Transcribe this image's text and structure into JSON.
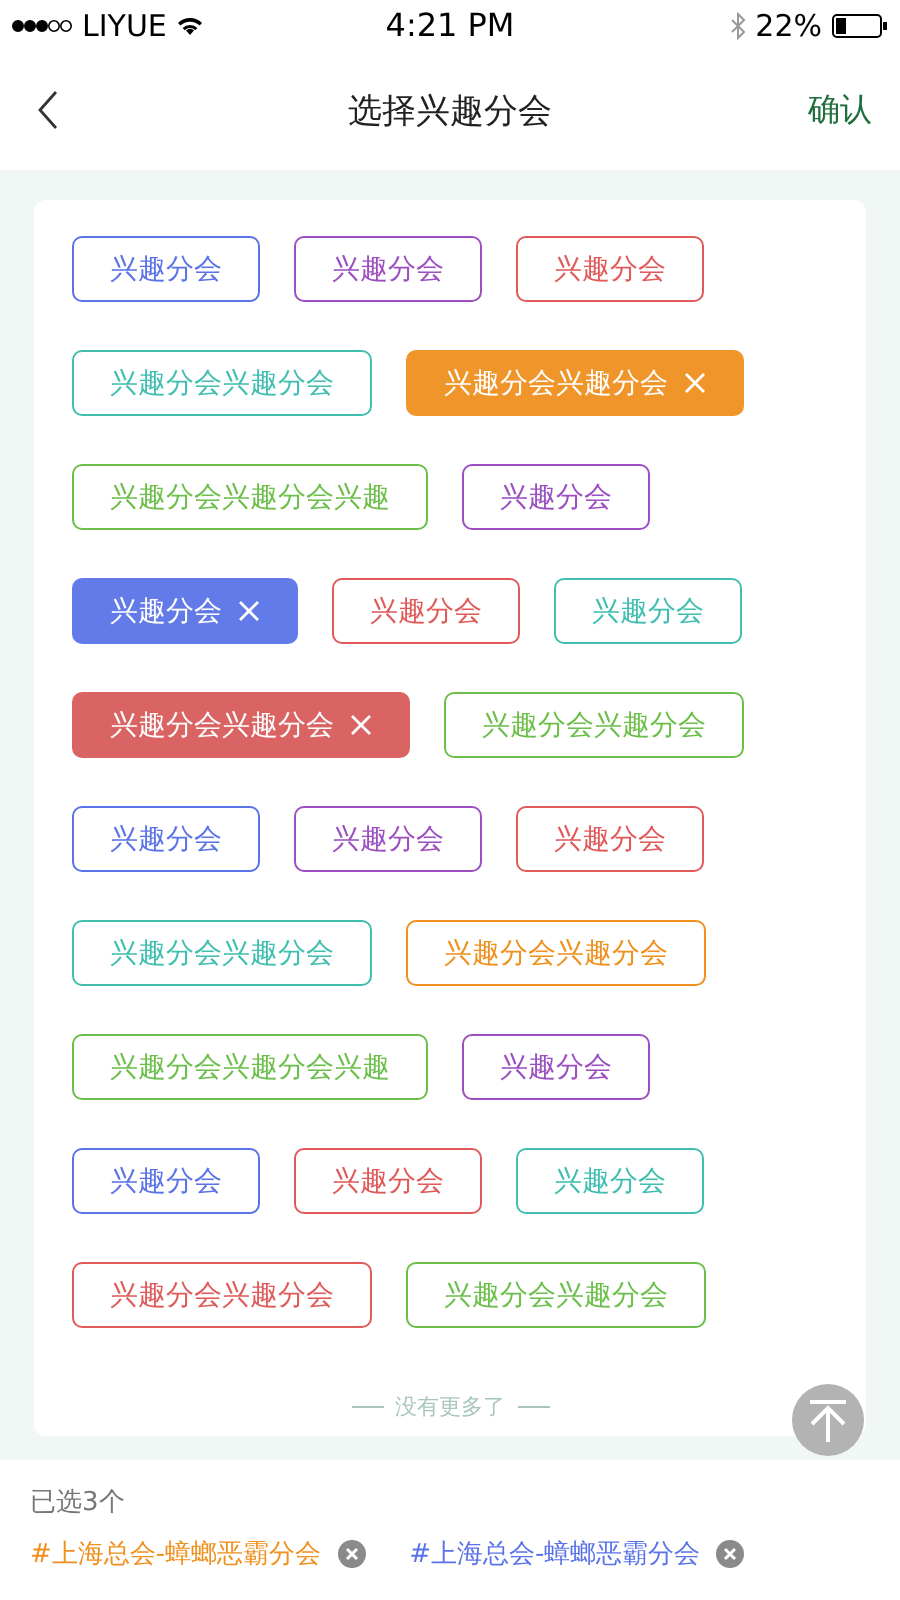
{
  "status_bar": {
    "carrier": "LIYUE",
    "time": "4:21 PM",
    "battery": "22%"
  },
  "nav": {
    "title": "选择兴趣分会",
    "confirm": "确认"
  },
  "tag_rows": [
    {
      "tags": [
        {
          "label": "兴趣分会",
          "color": "#5b73e8",
          "selected": false
        },
        {
          "label": "兴趣分会",
          "color": "#9b4fc0",
          "selected": false
        },
        {
          "label": "兴趣分会",
          "color": "#e05a5a",
          "selected": false
        }
      ]
    },
    {
      "tags": [
        {
          "label": "兴趣分会兴趣分会",
          "color": "#40bfb0",
          "selected": false
        },
        {
          "label": "兴趣分会兴趣分会",
          "color": "#f0901e",
          "selected": true
        }
      ]
    },
    {
      "tags": [
        {
          "label": "兴趣分会兴趣分会兴趣",
          "color": "#6cbf4a",
          "selected": false
        },
        {
          "label": "兴趣分会",
          "color": "#9b4fc0",
          "selected": false
        }
      ]
    },
    {
      "tags": [
        {
          "label": "兴趣分会",
          "color": "#5b73e8",
          "selected": true
        },
        {
          "label": "兴趣分会",
          "color": "#e05a5a",
          "selected": false
        },
        {
          "label": "兴趣分会",
          "color": "#40bfb0",
          "selected": false
        }
      ]
    },
    {
      "tags": [
        {
          "label": "兴趣分会兴趣分会",
          "color": "#d95c5c",
          "selected": true
        },
        {
          "label": "兴趣分会兴趣分会",
          "color": "#6cbf4a",
          "selected": false
        }
      ]
    },
    {
      "tags": [
        {
          "label": "兴趣分会",
          "color": "#5b73e8",
          "selected": false
        },
        {
          "label": "兴趣分会",
          "color": "#9b4fc0",
          "selected": false
        },
        {
          "label": "兴趣分会",
          "color": "#e05a5a",
          "selected": false
        }
      ]
    },
    {
      "tags": [
        {
          "label": "兴趣分会兴趣分会",
          "color": "#40bfb0",
          "selected": false
        },
        {
          "label": "兴趣分会兴趣分会",
          "color": "#f0901e",
          "selected": false
        }
      ]
    },
    {
      "tags": [
        {
          "label": "兴趣分会兴趣分会兴趣",
          "color": "#6cbf4a",
          "selected": false
        },
        {
          "label": "兴趣分会",
          "color": "#9b4fc0",
          "selected": false
        }
      ]
    },
    {
      "tags": [
        {
          "label": "兴趣分会",
          "color": "#5b73e8",
          "selected": false
        },
        {
          "label": "兴趣分会",
          "color": "#e05a5a",
          "selected": false
        },
        {
          "label": "兴趣分会",
          "color": "#40bfb0",
          "selected": false
        }
      ]
    },
    {
      "tags": [
        {
          "label": "兴趣分会兴趣分会",
          "color": "#e05a5a",
          "selected": false
        },
        {
          "label": "兴趣分会兴趣分会",
          "color": "#6cbf4a",
          "selected": false
        }
      ]
    }
  ],
  "end_note": "没有更多了",
  "selected_count": "已选3个",
  "selected_chips": [
    {
      "label": "#上海总会-蟑螂恶霸分会",
      "color": "#f0901e"
    },
    {
      "label": "#上海总会-蟑螂恶霸分会",
      "color": "#5b73e8"
    }
  ]
}
